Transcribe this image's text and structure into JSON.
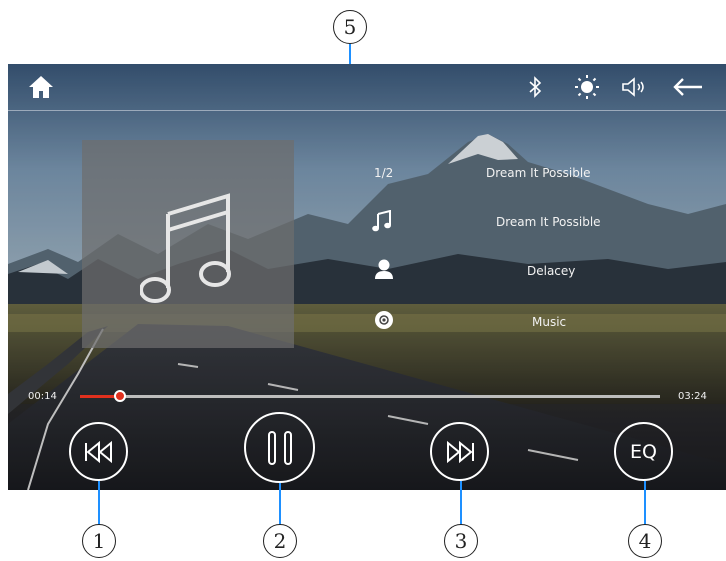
{
  "topbar": {
    "icons": [
      "home-icon",
      "bluetooth-icon",
      "brightness-icon",
      "volume-icon",
      "back-arrow-icon"
    ]
  },
  "track_info": {
    "counter": "1/2",
    "header_title": "Dream It Possible",
    "song_title": "Dream It Possible",
    "artist": "Delacey",
    "album": "Music"
  },
  "progress": {
    "elapsed": "00:14",
    "total": "03:24",
    "fraction": 0.069
  },
  "controls": {
    "eq_label": "EQ"
  },
  "callouts": {
    "c1": "1",
    "c2": "2",
    "c3": "3",
    "c4": "4",
    "c5": "5"
  },
  "colors": {
    "progress_accent": "#e0301e",
    "callout_line": "#1e90ff"
  }
}
